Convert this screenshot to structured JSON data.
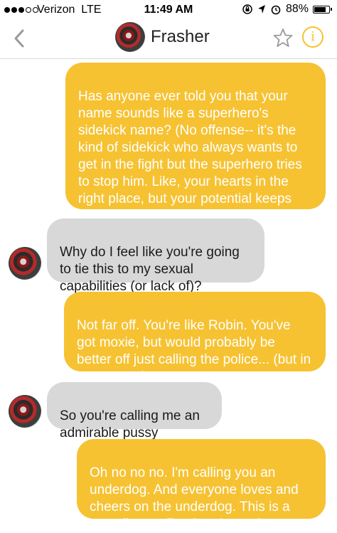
{
  "status_bar": {
    "carrier": "Verizon",
    "network": "LTE",
    "time": "11:49 AM",
    "battery": "88%",
    "battery_level": 0.88,
    "signal_bars": 3
  },
  "header": {
    "title": "Frasher",
    "back_icon": "chevron-left-icon",
    "star_icon": "star-icon",
    "info_icon": "info-icon",
    "info_glyph": "i",
    "accent_color": "#f6c232"
  },
  "messages": [
    {
      "direction": "outgoing",
      "text": "Has anyone ever told you that your name sounds like a superhero's sidekick name? (No offense-- it's the kind of sidekick who always wants to get in the fight but the superhero tries to stop him. Like, your hearts in the right place, but your potential keeps getting squashed, you know?)"
    },
    {
      "direction": "incoming",
      "text": "Why do I feel like you're going to tie this to my sexual capabilities (or lack of)?"
    },
    {
      "direction": "outgoing",
      "text": "Not far off. You're like Robin. You've got moxie, but would probably be better off just calling the police... (but in a cute way)"
    },
    {
      "direction": "incoming",
      "text": "So you're calling me an admirable pussy"
    },
    {
      "direction": "outgoing",
      "text": "Oh no no no. I'm calling you an underdog. And everyone loves and cheers on the underdog. This is a compliment, Frasher. I promise"
    }
  ]
}
